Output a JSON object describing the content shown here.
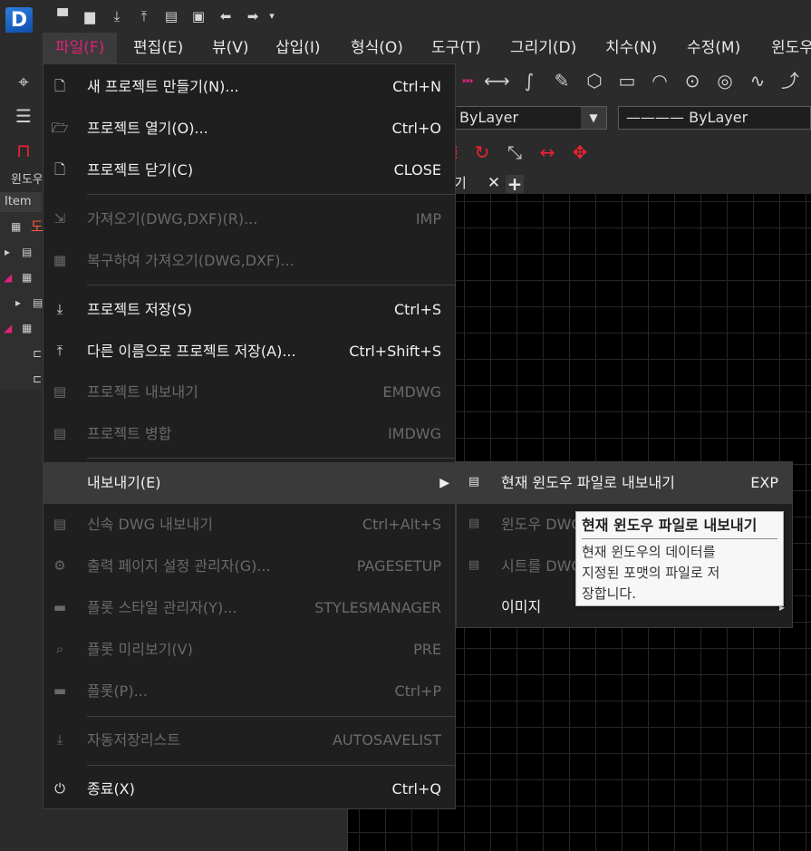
{
  "app": {
    "logo_letter": "D"
  },
  "quick_access": [
    {
      "icon": "new-file-icon",
      "glyph": "▀"
    },
    {
      "icon": "open-folder-icon",
      "glyph": "▆"
    },
    {
      "icon": "save-icon",
      "glyph": "⤓"
    },
    {
      "icon": "save-as-icon",
      "glyph": "⤒"
    },
    {
      "icon": "print-icon",
      "glyph": "▤"
    },
    {
      "icon": "close-file-icon",
      "glyph": "▣"
    },
    {
      "icon": "undo-icon",
      "glyph": "⬅"
    },
    {
      "icon": "redo-icon",
      "glyph": "➡"
    },
    {
      "icon": "customize-icon",
      "glyph": "▾"
    }
  ],
  "menubar": [
    {
      "label": "파일(F)",
      "active": true
    },
    {
      "label": "편집(E)"
    },
    {
      "label": "뷰(V)"
    },
    {
      "label": "삽입(I)"
    },
    {
      "label": "형식(O)"
    },
    {
      "label": "도구(T)"
    },
    {
      "label": "그리기(D)"
    },
    {
      "label": "치수(N)"
    },
    {
      "label": "수정(M)"
    },
    {
      "label": "윈도우"
    }
  ],
  "toolbar": {
    "draw_icons": [
      "dashed-line-icon",
      "line-icon",
      "spline-icon",
      "pen-icon",
      "polygon-icon",
      "rectangle-icon",
      "arc-icon",
      "circle-icon",
      "donut-icon",
      "curve-icon",
      "edit-curve-icon"
    ],
    "draw_glyphs": [
      "┅",
      "⟷",
      "∫",
      "✎",
      "⬡",
      "▭",
      "◠",
      "⊙",
      "◎",
      "∿",
      "⤴"
    ],
    "modify_icons": [
      "rotate-icon",
      "scale-icon",
      "stretch-icon",
      "explode-icon"
    ],
    "modify_glyphs": [
      "↻",
      "⤡",
      "↔",
      "✥"
    ],
    "color_combo": "ByLayer",
    "linetype_combo": "———— ByLayer"
  },
  "left_panel": {
    "title": "윈도우",
    "header": "Item",
    "tree_first": "도"
  },
  "doc_tab": {
    "label": "기",
    "close": "✕",
    "add": "+"
  },
  "file_menu": {
    "items": [
      {
        "label": "새 프로젝트 만들기(N)...",
        "shortcut": "Ctrl+N",
        "icon": "new-project-icon",
        "glyph": "🗋",
        "enabled": true
      },
      {
        "label": "프로젝트 열기(O)...",
        "shortcut": "Ctrl+O",
        "icon": "open-project-icon",
        "glyph": "🗁",
        "enabled": true
      },
      {
        "label": "프로젝트 닫기(C)",
        "shortcut": "CLOSE",
        "icon": "close-project-icon",
        "glyph": "🗋",
        "enabled": true
      },
      {
        "label": "가져오기(DWG,DXF)(R)...",
        "shortcut": "IMP",
        "icon": "import-icon",
        "glyph": "⇲",
        "enabled": false
      },
      {
        "label": "복구하여 가져오기(DWG,DXF)...",
        "shortcut": "",
        "icon": "recover-import-icon",
        "glyph": "▦",
        "enabled": false
      },
      {
        "label": "프로젝트 저장(S)",
        "shortcut": "Ctrl+S",
        "icon": "save-project-icon",
        "glyph": "⤓",
        "enabled": true
      },
      {
        "label": "다른 이름으로 프로젝트 저장(A)...",
        "shortcut": "Ctrl+Shift+S",
        "icon": "save-as-project-icon",
        "glyph": "⤒",
        "enabled": true
      },
      {
        "label": "프로젝트 내보내기",
        "shortcut": "EMDWG",
        "icon": "export-project-icon",
        "glyph": "▤",
        "enabled": false
      },
      {
        "label": "프로젝트 병합",
        "shortcut": "IMDWG",
        "icon": "merge-project-icon",
        "glyph": "▤",
        "enabled": false
      },
      {
        "label": "내보내기(E)",
        "shortcut": "",
        "icon": "",
        "glyph": "",
        "enabled": true,
        "submenu": true
      },
      {
        "label": "신속 DWG 내보내기",
        "shortcut": "Ctrl+Alt+S",
        "icon": "quick-dwg-export-icon",
        "glyph": "▤",
        "enabled": false
      },
      {
        "label": "출력 페이지 설정 관리자(G)...",
        "shortcut": "PAGESETUP",
        "icon": "page-setup-icon",
        "glyph": "⚙",
        "enabled": false
      },
      {
        "label": "플롯 스타일 관리자(Y)...",
        "shortcut": "STYLESMANAGER",
        "icon": "plot-style-icon",
        "glyph": "▬",
        "enabled": false
      },
      {
        "label": "플롯 미리보기(V)",
        "shortcut": "PRE",
        "icon": "plot-preview-icon",
        "glyph": "⌕",
        "enabled": false
      },
      {
        "label": "플롯(P)...",
        "shortcut": "Ctrl+P",
        "icon": "plot-icon",
        "glyph": "▬",
        "enabled": false
      },
      {
        "label": "자동저장리스트",
        "shortcut": "AUTOSAVELIST",
        "icon": "autosave-list-icon",
        "glyph": "⤓",
        "enabled": false
      },
      {
        "label": "종료(X)",
        "shortcut": "Ctrl+Q",
        "icon": "power-icon",
        "glyph": "⏻",
        "enabled": true
      }
    ],
    "submenu_arrow": "▶"
  },
  "export_submenu": {
    "items": [
      {
        "label": "현재 윈도우 파일로 내보내기",
        "shortcut": "EXP",
        "icon": "dwg-export-icon",
        "glyph": "▤",
        "enabled": true
      },
      {
        "label": "윈도우 DWG",
        "shortcut": "",
        "icon": "window-dwg-icon",
        "glyph": "▤",
        "enabled": false
      },
      {
        "label": "시트를 DWG",
        "shortcut": "",
        "icon": "sheet-dwg-icon",
        "glyph": "▤",
        "enabled": false
      },
      {
        "label": "이미지",
        "shortcut": "",
        "icon": "",
        "glyph": "",
        "enabled": true,
        "submenu": true
      }
    ],
    "submenu_arrow": "▸"
  },
  "tooltip": {
    "title": "현재 윈도우 파일로 내보내기",
    "body_line1": "현재 윈도우의 데이터를",
    "body_line2": "지정된 포맷의 파일로 저",
    "body_line3": "장합니다."
  }
}
